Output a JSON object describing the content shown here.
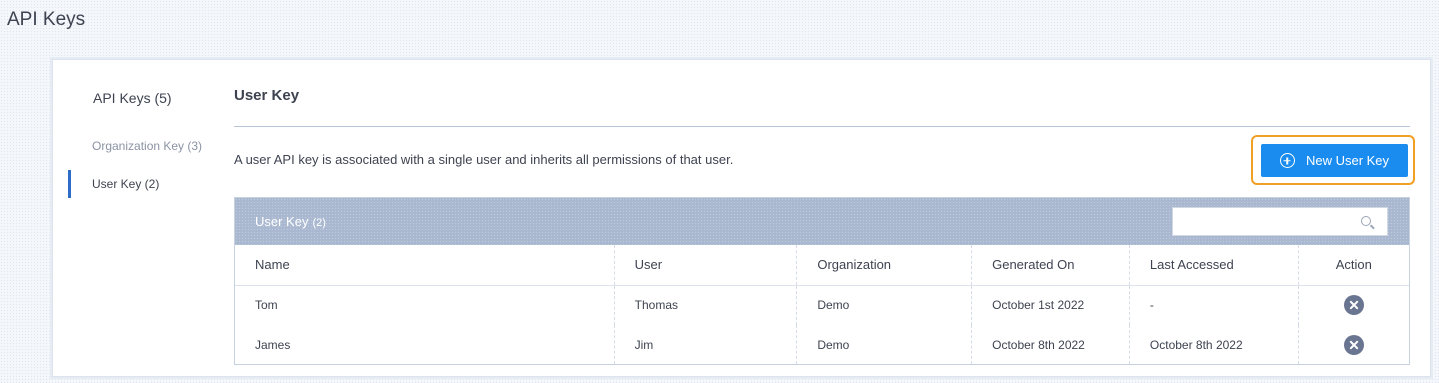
{
  "page": {
    "title": "API Keys"
  },
  "sidebar": {
    "title": "API Keys (5)",
    "items": [
      {
        "label": "Organization Key (3)",
        "active": false
      },
      {
        "label": "User Key (2)",
        "active": true
      }
    ]
  },
  "main": {
    "title": "User Key",
    "description": "A user API key is associated with a single user and inherits all permissions of that user.",
    "new_button_label": "New User Key",
    "new_button_icon": "plus-circle-icon"
  },
  "table": {
    "title": "User Key",
    "count": "(2)",
    "search_placeholder": "",
    "search_icon": "search-icon",
    "columns": [
      "Name",
      "User",
      "Organization",
      "Generated On",
      "Last Accessed",
      "Action"
    ],
    "rows": [
      {
        "name": "Tom",
        "user": "Thomas",
        "organization": "Demo",
        "generated_on": "October 1st 2022",
        "last_accessed": "-",
        "action_icon": "delete-icon"
      },
      {
        "name": "James",
        "user": "Jim",
        "organization": "Demo",
        "generated_on": "October 8th 2022",
        "last_accessed": "October 8th 2022",
        "action_icon": "delete-icon"
      }
    ]
  },
  "colors": {
    "primary_button": "#1a8cf0",
    "highlight_outline": "#f0a024",
    "table_header": "#a9b8d0",
    "active_indicator": "#2d6bc8"
  }
}
